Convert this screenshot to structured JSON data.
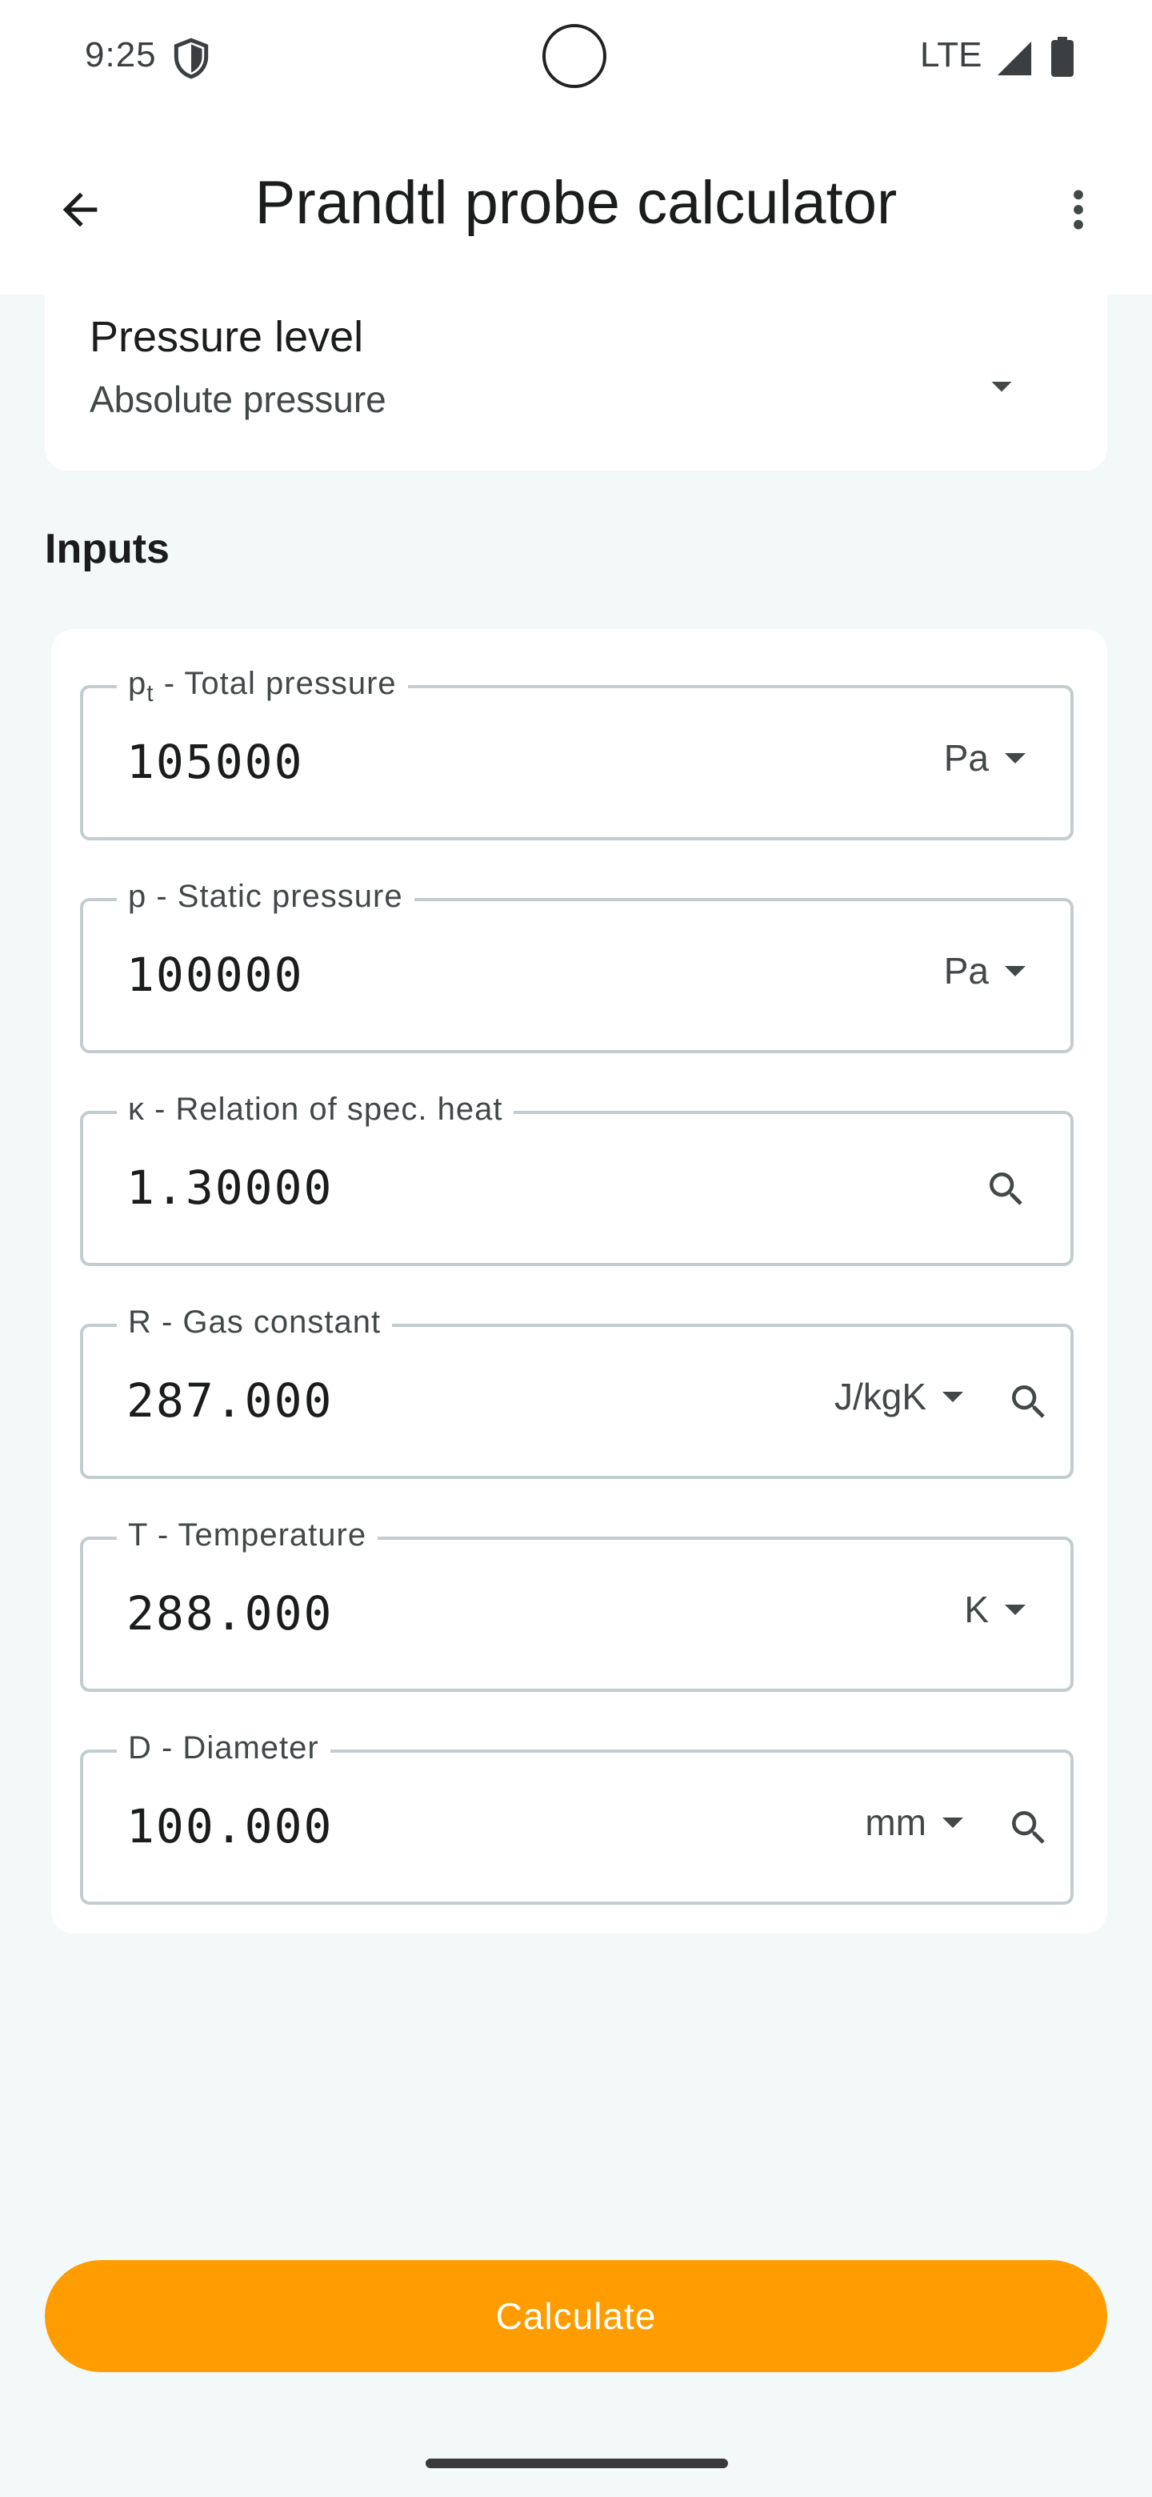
{
  "status_bar": {
    "time": "9:25",
    "network": "LTE"
  },
  "app_bar": {
    "title": "Prandtl probe calculator"
  },
  "pressure_level": {
    "label": "Pressure level",
    "value": "Absolute pressure"
  },
  "inputs": {
    "title": "Inputs",
    "fields": [
      {
        "symbol": "p",
        "subscript": "t",
        "label": " - Total pressure",
        "value": "105000",
        "unit": "Pa"
      },
      {
        "label": "p - Static pressure",
        "value": "100000",
        "unit": "Pa"
      },
      {
        "label": "κ - Relation of spec. heat",
        "value": "1.30000"
      },
      {
        "label": "R - Gas constant",
        "value": "287.000",
        "unit": "J/kgK"
      },
      {
        "label": "T - Temperature",
        "value": "288.000",
        "unit": "K"
      },
      {
        "label": "D - Diameter",
        "value": "100.000",
        "unit": "mm"
      }
    ]
  },
  "calculate_label": "Calculate",
  "colors": {
    "accent": "#ff9d00",
    "background": "#f3f8f9",
    "outline": "#c3ccce"
  },
  "icons": [
    "shield-icon",
    "signal-icon",
    "battery-icon",
    "back-arrow-icon",
    "more-vert-icon",
    "dropdown-arrow-icon",
    "search-icon"
  ]
}
